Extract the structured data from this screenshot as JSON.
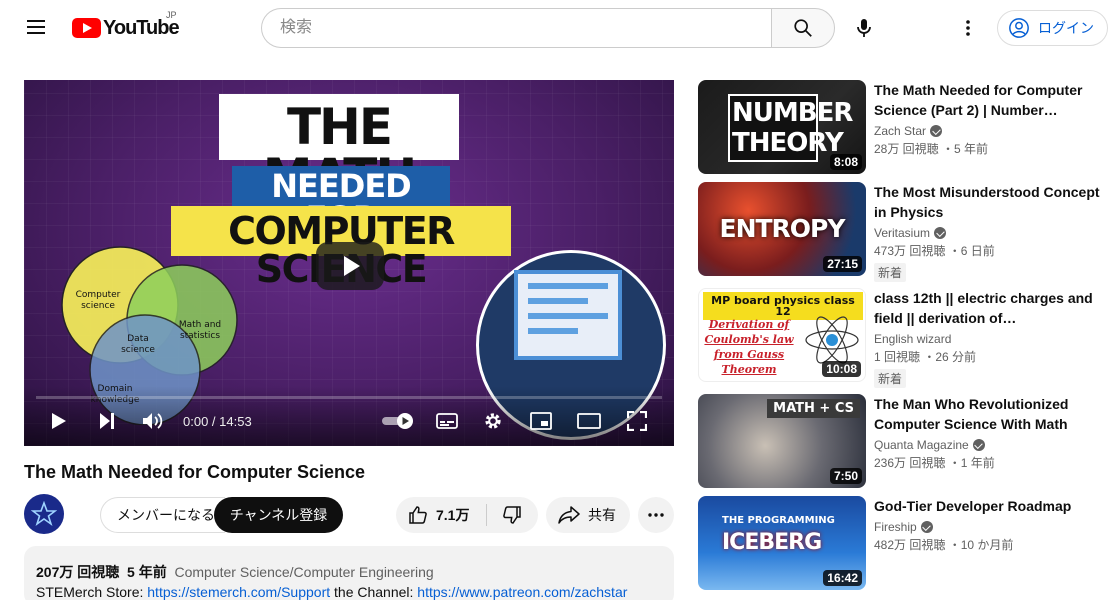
{
  "header": {
    "logo_text": "YouTube",
    "region": "JP",
    "search_placeholder": "検索",
    "login_label": "ログイン"
  },
  "player": {
    "thumbnail_text": {
      "line1": "THE MATH",
      "line2": "NEEDED FOR",
      "line3": "COMPUTER SCIENCE"
    },
    "venn": {
      "cs": "Computer science",
      "math": "Math and statistics",
      "data": "Data science",
      "domain": "Domain knowledge"
    },
    "time_display": "0:00 / 14:53",
    "progress": 0
  },
  "video": {
    "title": "The Math Needed for Computer Science",
    "member_label": "メンバーになる",
    "subscribe_label": "チャンネル登録",
    "likes": "7.1万",
    "share_label": "共有",
    "views": "207万 回視聴",
    "age": "5 年前",
    "category": "Computer Science/Computer Engineering",
    "desc_prefix": "STEMerch Store: ",
    "link1": "https://stemerch.com/Support",
    "desc_mid": " the Channel: ",
    "link2": "https://www.patreon.com/zachstar"
  },
  "recommendations": [
    {
      "title": "The Math Needed for Computer Science (Part 2) | Number…",
      "channel": "Zach Star",
      "verified": true,
      "meta": "28万 回視聴 ・5 年前",
      "duration": "8:08",
      "thumb_text": "NUMBER THEORY",
      "badge": ""
    },
    {
      "title": "The Most Misunderstood Concept in Physics",
      "channel": "Veritasium",
      "verified": true,
      "meta": "473万 回視聴 ・6 日前",
      "duration": "27:15",
      "thumb_text": "ENTROPY",
      "badge": "新着"
    },
    {
      "title": "class 12th || electric charges and field || derivation of…",
      "channel": "English wizard",
      "verified": false,
      "meta": "1 回視聴 ・26 分前",
      "duration": "10:08",
      "thumb_text": "MP board physics class 12",
      "thumb_sub": "Derivation of Coulomb's law from Gauss Theorem",
      "badge": "新着"
    },
    {
      "title": "The Man Who Revolutionized Computer Science With Math",
      "channel": "Quanta Magazine",
      "verified": true,
      "meta": "236万 回視聴 ・1 年前",
      "duration": "7:50",
      "thumb_text": "MATH + CS",
      "badge": ""
    },
    {
      "title": "God-Tier Developer Roadmap",
      "channel": "Fireship",
      "verified": true,
      "meta": "482万 回視聴 ・10 か月前",
      "duration": "16:42",
      "thumb_text": "THE PROGRAMMING",
      "thumb_sub": "ICEBERG",
      "badge": ""
    }
  ]
}
